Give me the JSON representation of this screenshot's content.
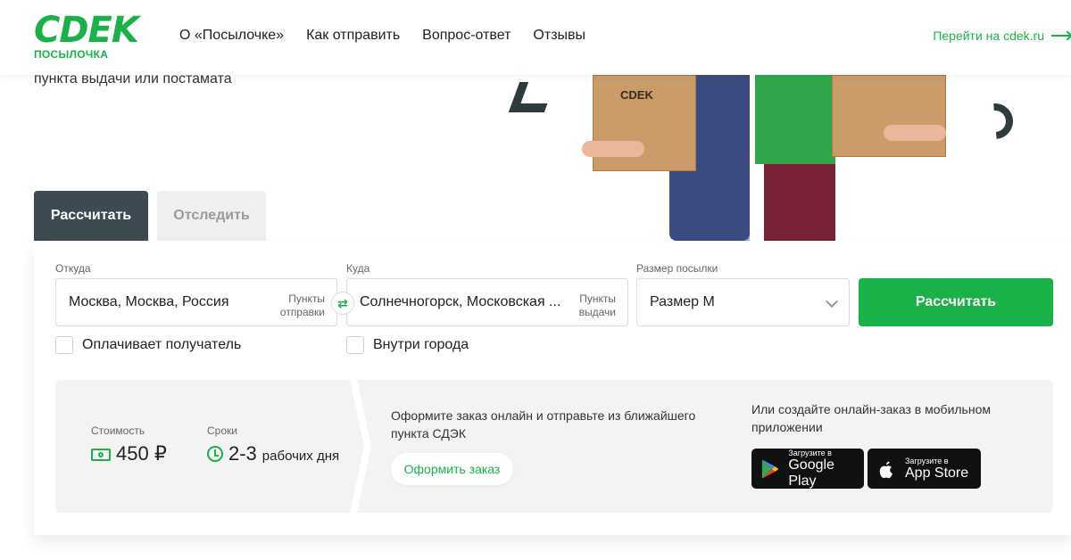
{
  "header": {
    "logo_text": "CDEK",
    "logo_sub": "ПОСЫЛОЧКА",
    "nav": [
      "О «Посылочке»",
      "Как отправить",
      "Вопрос-ответ",
      "Отзывы"
    ],
    "external_link": "Перейти на cdek.ru"
  },
  "hero": {
    "text": "пункта выдачи или постамата",
    "box_label": "CDEK"
  },
  "tabs": {
    "calculate": "Рассчитать",
    "track": "Отследить"
  },
  "form": {
    "from_label": "Откуда",
    "from_value": "Москва, Москва, Россия",
    "from_hint_line1": "Пункты",
    "from_hint_line2": "отправки",
    "to_label": "Куда",
    "to_value": "Солнечногорск, Московская ...",
    "to_hint_line1": "Пункты",
    "to_hint_line2": "выдачи",
    "size_label": "Размер посылки",
    "size_value": "Размер М",
    "submit_label": "Рассчитать",
    "checkbox_recipient_pays": "Оплачивает получатель",
    "checkbox_within_city": "Внутри города"
  },
  "result": {
    "cost_label": "Стоимость",
    "cost_value": "450 ₽",
    "term_label": "Сроки",
    "term_value": "2-3",
    "term_unit": "рабочих дня",
    "order_text": "Оформите заказ онлайн и отправьте из ближайшего пункта СДЭК",
    "order_button": "Оформить заказ",
    "app_text": "Или создайте онлайн-заказ в мобильном приложении",
    "google_small": "Загрузите в",
    "google_big": "Google Play",
    "apple_small": "Загрузите в",
    "apple_big": "App Store"
  },
  "colors": {
    "brand_green": "#1ab248",
    "tab_dark": "#3e4a52"
  }
}
